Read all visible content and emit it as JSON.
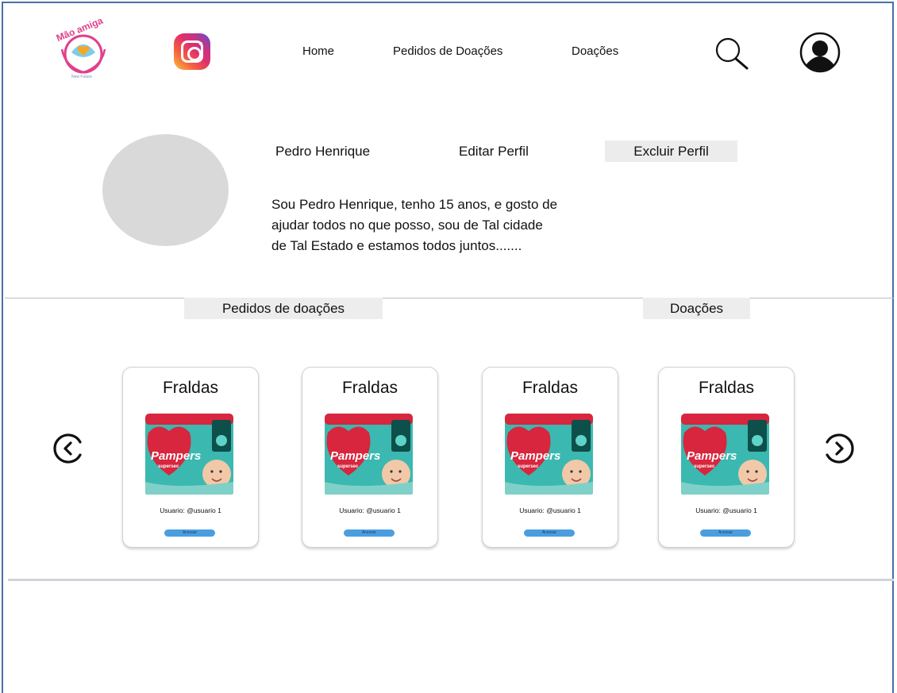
{
  "header": {
    "logo_text": "Mão amiga",
    "logo_tagline": "New Future",
    "nav": {
      "home": "Home",
      "pedidos": "Pedidos de Doações",
      "doacoes": "Doações"
    },
    "icons": [
      "instagram-icon",
      "search-icon",
      "user-icon"
    ]
  },
  "profile": {
    "name": "Pedro Henrique",
    "edit_label": "Editar Perfil",
    "delete_label": "Excluir Perfil",
    "bio_lines": [
      "Sou Pedro Henrique, tenho 15 anos, e gosto de",
      "ajudar todos no que posso, sou de Tal cidade",
      "de Tal Estado e estamos todos juntos......."
    ]
  },
  "tabs": {
    "pedidos": "Pedidos de doações",
    "doacoes": "Doações"
  },
  "cards": [
    {
      "title": "Fraldas",
      "user": "Usuario: @usuario 1",
      "button": "Acessar"
    },
    {
      "title": "Fraldas",
      "user": "Usuario: @usuario 1",
      "button": "Acessar"
    },
    {
      "title": "Fraldas",
      "user": "Usuario: @usuario 1",
      "button": "Acessar"
    },
    {
      "title": "Fraldas",
      "user": "Usuario: @usuario 1",
      "button": "Acessar"
    }
  ],
  "product_image": {
    "brand": "Pampers",
    "line": "supersec"
  },
  "colors": {
    "frame": "#4a6fa5",
    "button": "#4a9ee0",
    "logo_pink": "#e0408a"
  }
}
